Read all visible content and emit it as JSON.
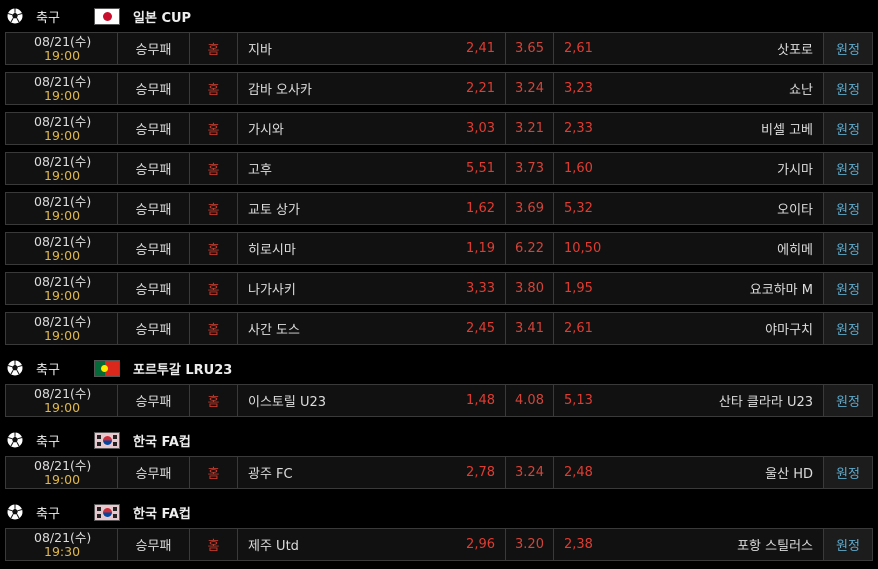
{
  "groups": [
    {
      "sport": "축구",
      "league": "일본 CUP",
      "flag": "japan",
      "matches": [
        {
          "date": "08/21(수)",
          "time": "19:00",
          "type": "승무패",
          "home_label": "홈",
          "home": "지바",
          "home_odd": "2,41",
          "draw": "3.65",
          "away_odd": "2,61",
          "away": "삿포로",
          "away_label": "원정"
        },
        {
          "date": "08/21(수)",
          "time": "19:00",
          "type": "승무패",
          "home_label": "홈",
          "home": "감바 오사카",
          "home_odd": "2,21",
          "draw": "3.24",
          "away_odd": "3,23",
          "away": "쇼난",
          "away_label": "원정"
        },
        {
          "date": "08/21(수)",
          "time": "19:00",
          "type": "승무패",
          "home_label": "홈",
          "home": "가시와",
          "home_odd": "3,03",
          "draw": "3.21",
          "away_odd": "2,33",
          "away": "비셀 고베",
          "away_label": "원정"
        },
        {
          "date": "08/21(수)",
          "time": "19:00",
          "type": "승무패",
          "home_label": "홈",
          "home": "고후",
          "home_odd": "5,51",
          "draw": "3.73",
          "away_odd": "1,60",
          "away": "가시마",
          "away_label": "원정"
        },
        {
          "date": "08/21(수)",
          "time": "19:00",
          "type": "승무패",
          "home_label": "홈",
          "home": "교토 상가",
          "home_odd": "1,62",
          "draw": "3.69",
          "away_odd": "5,32",
          "away": "오이타",
          "away_label": "원정"
        },
        {
          "date": "08/21(수)",
          "time": "19:00",
          "type": "승무패",
          "home_label": "홈",
          "home": "히로시마",
          "home_odd": "1,19",
          "draw": "6.22",
          "away_odd": "10,50",
          "away": "에히메",
          "away_label": "원정"
        },
        {
          "date": "08/21(수)",
          "time": "19:00",
          "type": "승무패",
          "home_label": "홈",
          "home": "나가사키",
          "home_odd": "3,33",
          "draw": "3.80",
          "away_odd": "1,95",
          "away": "요코하마 M",
          "away_label": "원정"
        },
        {
          "date": "08/21(수)",
          "time": "19:00",
          "type": "승무패",
          "home_label": "홈",
          "home": "사간 도스",
          "home_odd": "2,45",
          "draw": "3.41",
          "away_odd": "2,61",
          "away": "야마구치",
          "away_label": "원정"
        }
      ]
    },
    {
      "sport": "축구",
      "league": "포르투갈 LRU23",
      "flag": "portugal",
      "matches": [
        {
          "date": "08/21(수)",
          "time": "19:00",
          "type": "승무패",
          "home_label": "홈",
          "home": "이스토릴 U23",
          "home_odd": "1,48",
          "draw": "4.08",
          "away_odd": "5,13",
          "away": "산타 클라라 U23",
          "away_label": "원정"
        }
      ]
    },
    {
      "sport": "축구",
      "league": "한국 FA컵",
      "flag": "korea",
      "matches": [
        {
          "date": "08/21(수)",
          "time": "19:00",
          "type": "승무패",
          "home_label": "홈",
          "home": "광주 FC",
          "home_odd": "2,78",
          "draw": "3.24",
          "away_odd": "2,48",
          "away": "울산 HD",
          "away_label": "원정"
        }
      ]
    },
    {
      "sport": "축구",
      "league": "한국 FA컵",
      "flag": "korea",
      "matches": [
        {
          "date": "08/21(수)",
          "time": "19:30",
          "type": "승무패",
          "home_label": "홈",
          "home": "제주 Utd",
          "home_odd": "2,96",
          "draw": "3.20",
          "away_odd": "2,38",
          "away": "포항 스틸러스",
          "away_label": "원정"
        }
      ]
    }
  ],
  "colors": {
    "odd": "#e03c31",
    "time": "#e0b84a",
    "away_label": "#5fa8c8",
    "border": "#3a3a3a"
  }
}
